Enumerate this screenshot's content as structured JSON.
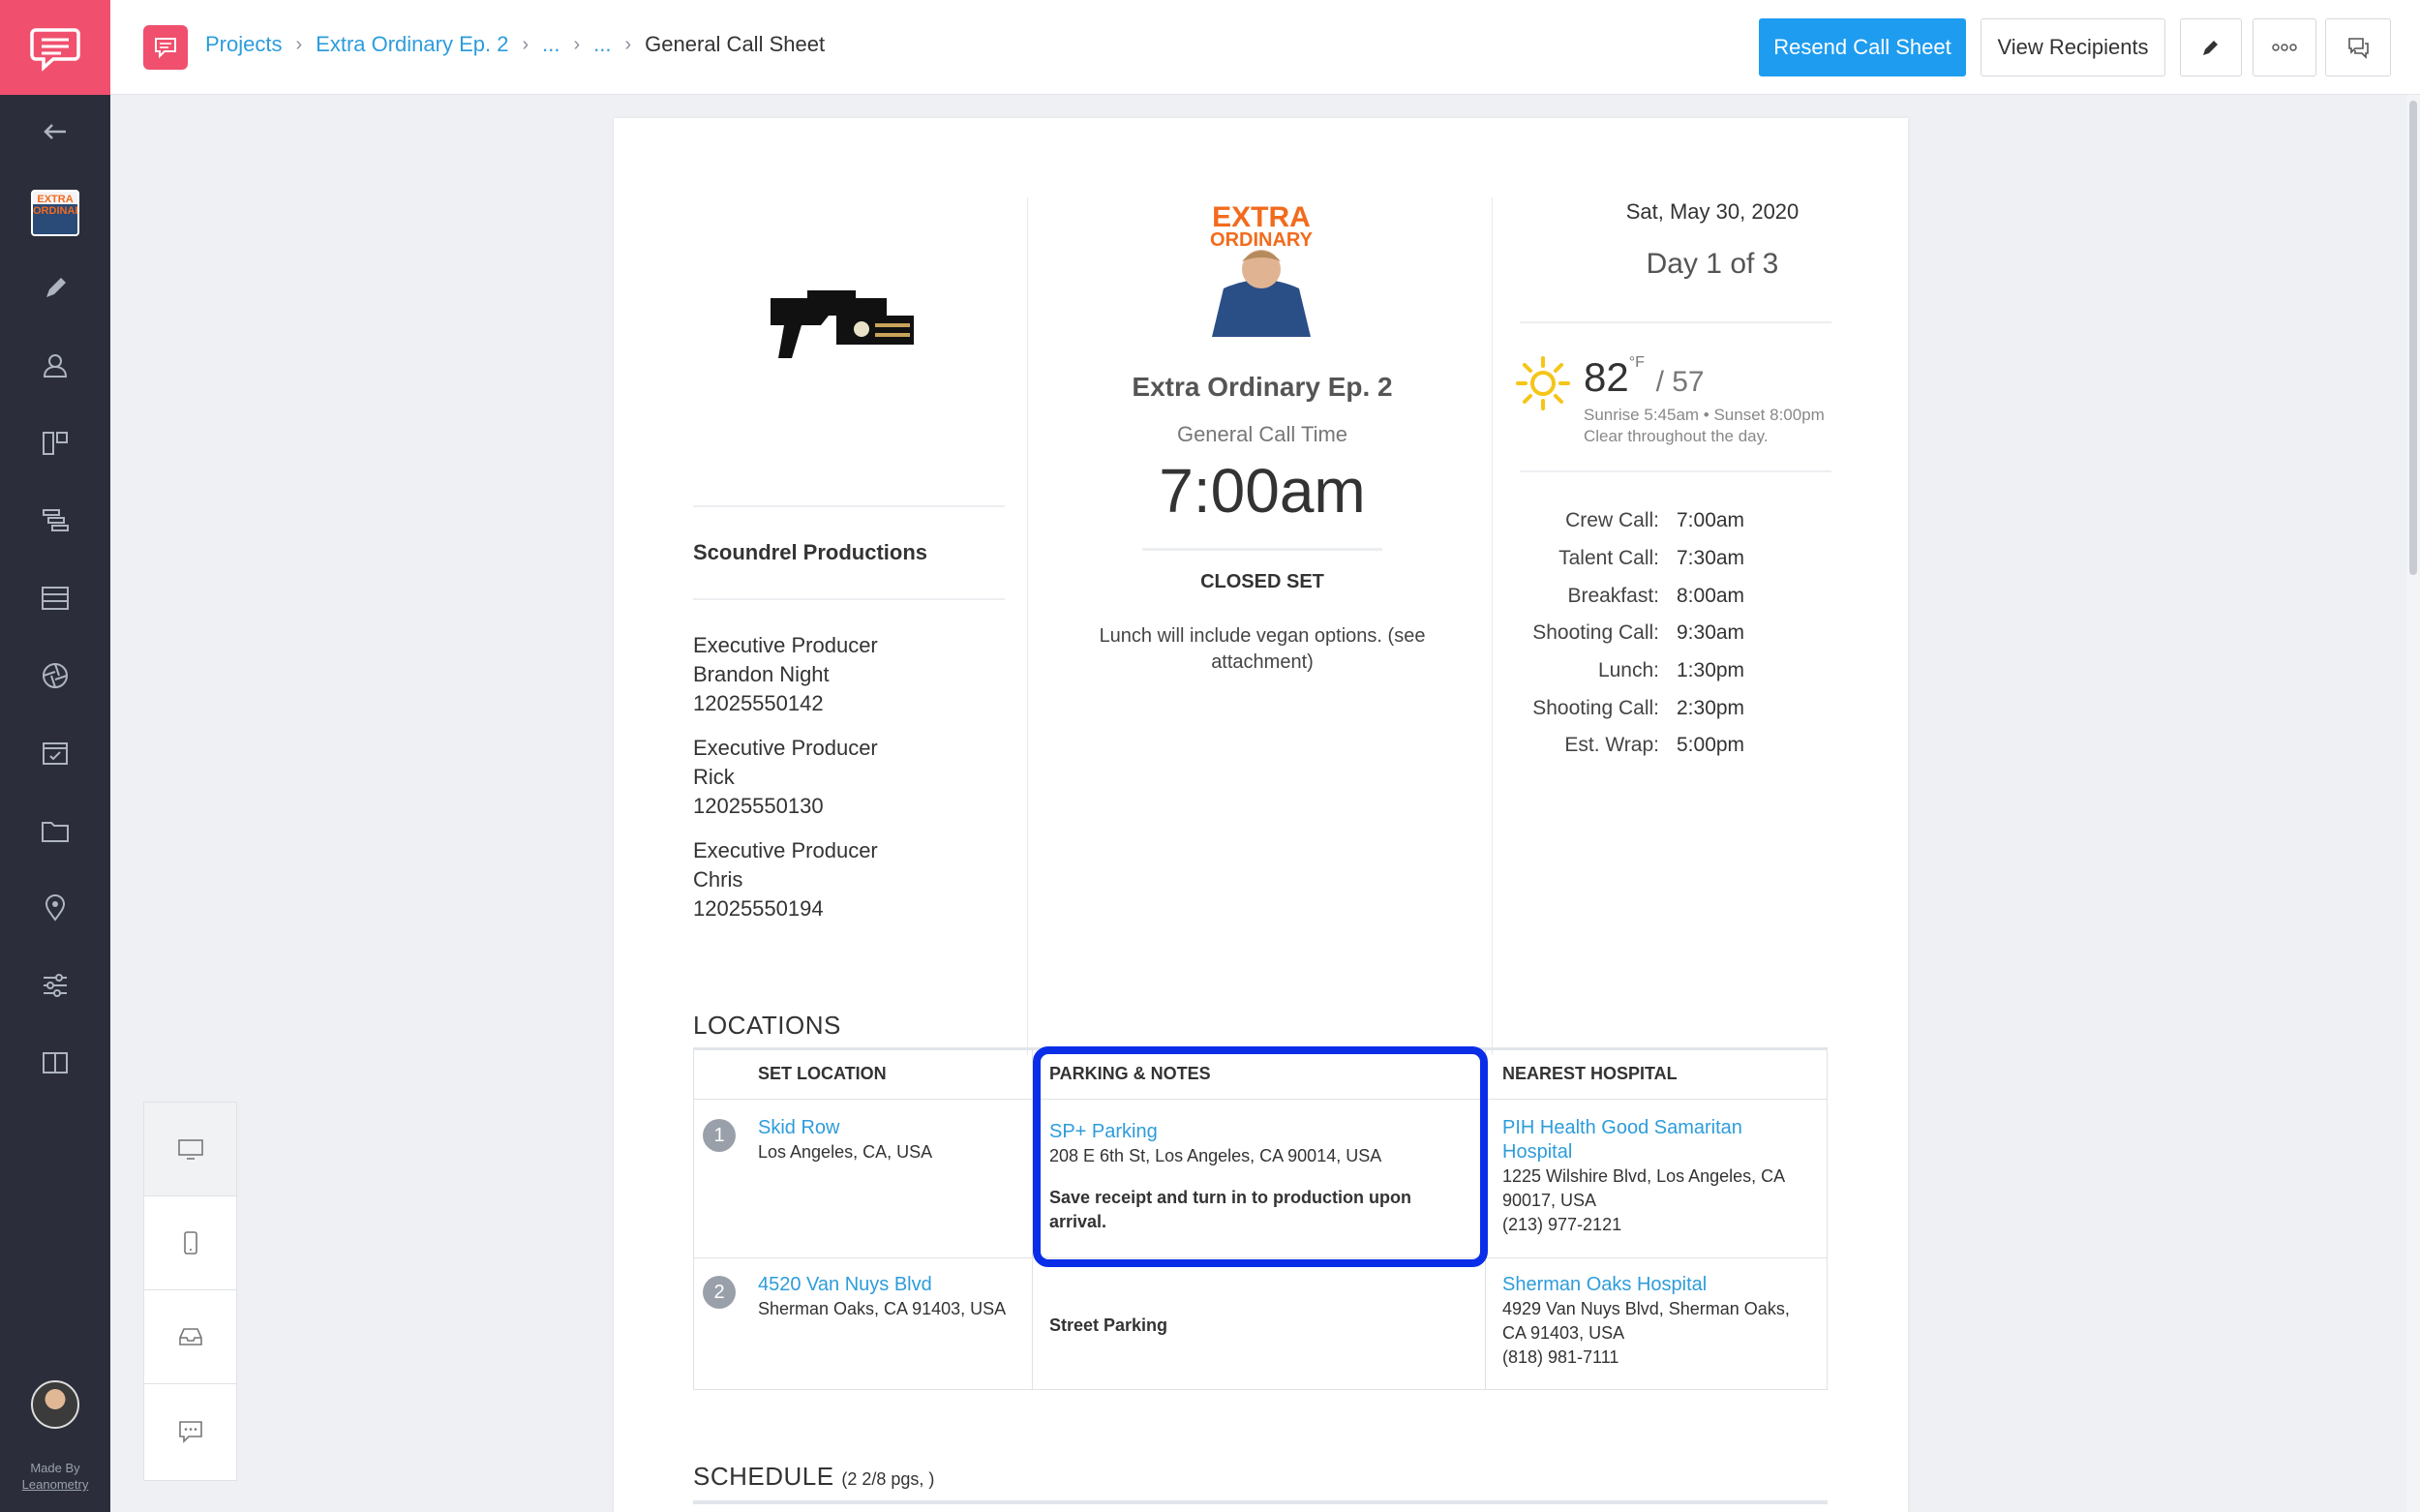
{
  "breadcrumb": {
    "items": [
      "Projects",
      "Extra Ordinary Ep. 2",
      "...",
      "..."
    ],
    "current": "General Call Sheet"
  },
  "toolbar": {
    "resend_label": "Resend Call Sheet",
    "view_label": "View Recipients"
  },
  "sidebar": {
    "made_by_line1": "Made By",
    "made_by_line2": "Leanometry",
    "project_thumb_text": "EXTRA ORDINARY"
  },
  "sheet": {
    "company_name": "Scoundrel Productions",
    "producers": [
      {
        "role": "Executive Producer",
        "name": "Brandon Night",
        "phone": "12025550142"
      },
      {
        "role": "Executive Producer",
        "name": "Rick",
        "phone": "12025550130"
      },
      {
        "role": "Executive Producer",
        "name": "Chris",
        "phone": "12025550194"
      }
    ],
    "show_logo_text_1": "EXTRA",
    "show_logo_text_2": "ORDINARY",
    "show_title": "Extra Ordinary Ep. 2",
    "general_call_label": "General Call Time",
    "general_call_time": "7:00am",
    "closed_set": "CLOSED SET",
    "note": "Lunch will include vegan options. (see attachment)",
    "date": "Sat, May 30, 2020",
    "day": "Day 1 of 3",
    "weather": {
      "high": "82",
      "unit": "°F",
      "low": "/ 57",
      "sun": "Sunrise 5:45am • Sunset 8:00pm",
      "summary": "Clear throughout the day."
    },
    "calls": [
      {
        "label": "Crew Call:",
        "time": "7:00am"
      },
      {
        "label": "Talent Call:",
        "time": "7:30am"
      },
      {
        "label": "Breakfast:",
        "time": "8:00am"
      },
      {
        "label": "Shooting Call:",
        "time": "9:30am"
      },
      {
        "label": "Lunch:",
        "time": "1:30pm"
      },
      {
        "label": "Shooting Call:",
        "time": "2:30pm"
      },
      {
        "label": "Est. Wrap:",
        "time": "5:00pm"
      }
    ]
  },
  "locations": {
    "title": "LOCATIONS",
    "headers": [
      "SET LOCATION",
      "PARKING & NOTES",
      "NEAREST HOSPITAL"
    ],
    "rows": [
      {
        "num": "1",
        "set_name": "Skid Row",
        "set_address": "Los Angeles, CA, USA",
        "parking_name": "SP+ Parking",
        "parking_address": "208 E 6th St, Los Angeles, CA 90014, USA",
        "parking_note": "Save receipt and turn in to production upon arrival.",
        "hospital_name": "PIH Health Good Samaritan Hospital",
        "hospital_address": "1225 Wilshire Blvd, Los Angeles, CA 90017, USA",
        "hospital_phone": "(213) 977-2121"
      },
      {
        "num": "2",
        "set_name": "4520 Van Nuys Blvd",
        "set_address": "Sherman Oaks, CA 91403, USA",
        "parking_note": "Street Parking",
        "hospital_name": "Sherman Oaks Hospital",
        "hospital_address": "4929 Van Nuys Blvd, Sherman Oaks, CA 91403, USA",
        "hospital_phone": "(818) 981-7111"
      }
    ]
  },
  "schedule": {
    "title": "SCHEDULE",
    "pages": "(2 2/8 pgs, )"
  }
}
